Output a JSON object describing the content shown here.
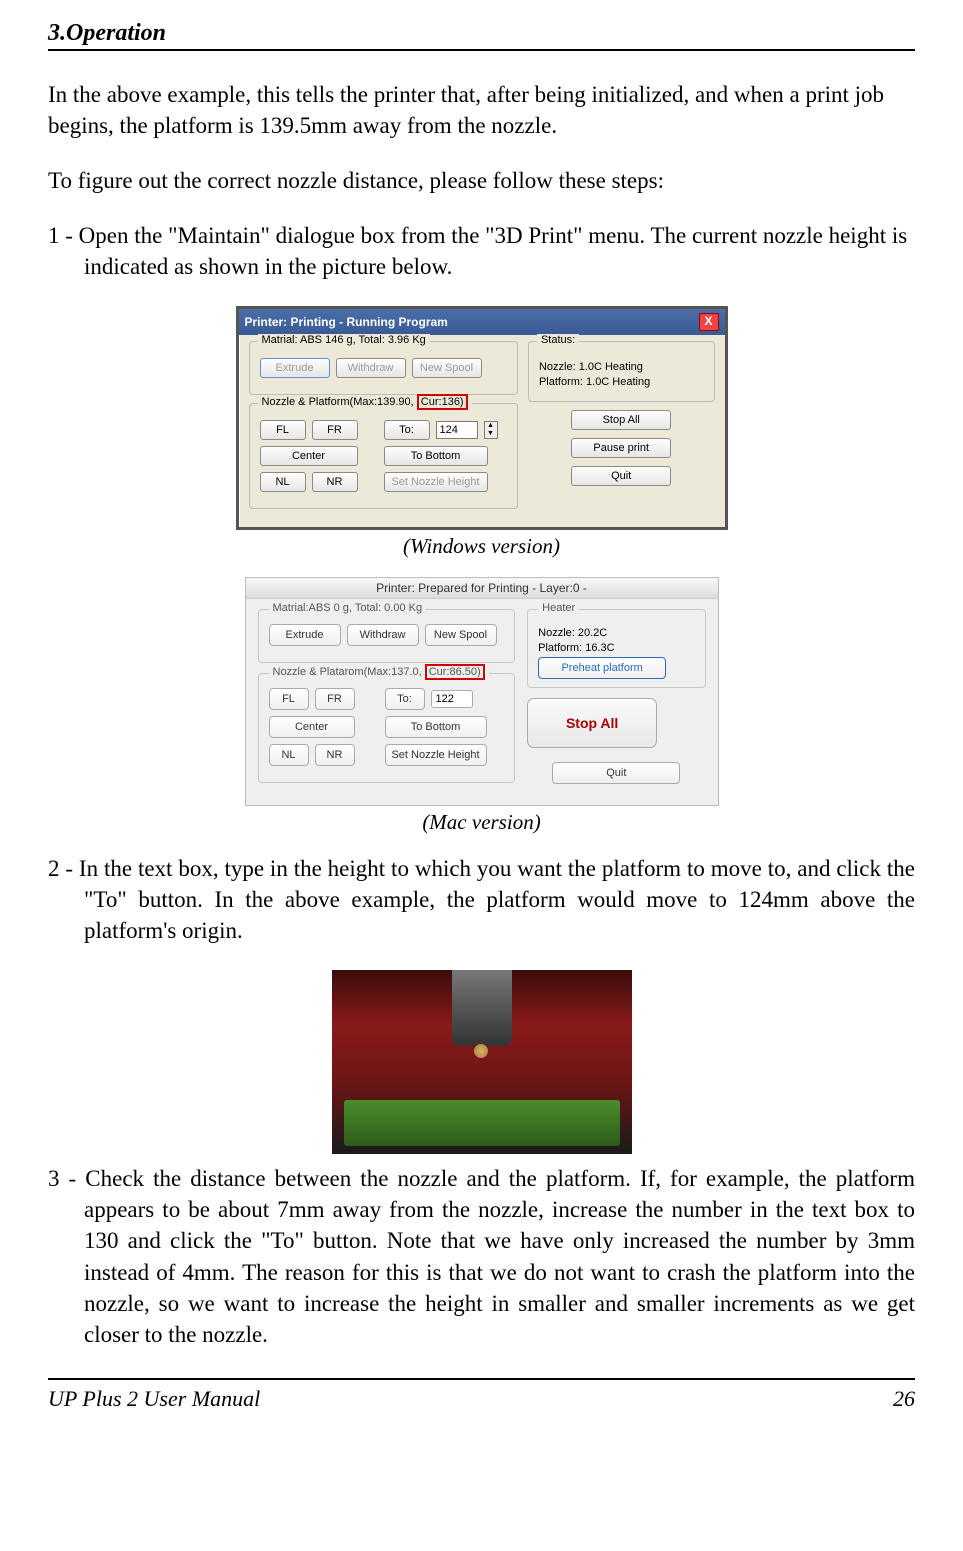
{
  "header": {
    "section": "3.Operation"
  },
  "paragraphs": {
    "intro": "In the above example, this tells the printer that, after being initialized, and when a print job begins, the platform is 139.5mm away from the nozzle.",
    "followSteps": "To figure out the correct nozzle distance, please follow these steps:",
    "step1": "1 - Open the \"Maintain\" dialogue box from the \"3D Print\" menu. The current nozzle height is indicated as shown in the picture below.",
    "step2": "2 - In the text box, type in the height to which you want the platform to move to, and click the \"To\" button. In the above example, the platform would move to 124mm above the platform's origin.",
    "step3": "3 - Check the distance between the nozzle and the platform. If, for example, the platform appears to be about 7mm away from the nozzle, increase the number in the text box to 130 and click the \"To\" button. Note that we have only increased the number by 3mm instead of 4mm. The reason for this is that we do not want to crash the platform into the nozzle, so we want to increase the height in smaller and smaller increments as we get closer to the nozzle."
  },
  "captions": {
    "windows": "(Windows version)",
    "mac": "(Mac version)"
  },
  "winDialog": {
    "title": "Printer: Printing - Running Program",
    "material": "Matrial: ABS 146 g,  Total: 3.96 Kg",
    "buttons": {
      "extrude": "Extrude",
      "withdraw": "Withdraw",
      "newSpool": "New Spool"
    },
    "nozzlePlat": "Nozzle & Platform(Max:139.90,",
    "curHighlight": "Cur:136)",
    "nav": {
      "fl": "FL",
      "fr": "FR",
      "to": "To:",
      "toVal": "124",
      "center": "Center",
      "toBottom": "To Bottom",
      "nl": "NL",
      "nr": "NR",
      "setHeight": "Set Nozzle Height"
    },
    "status": {
      "hdr": "Status:",
      "nozzle": "Nozzle: 1.0C Heating",
      "platform": "Platform: 1.0C Heating",
      "stopAll": "Stop All",
      "pause": "Pause print",
      "quit": "Quit"
    }
  },
  "macDialog": {
    "title": "Printer: Prepared for Printing - Layer:0 -",
    "material": "Matrial:ABS 0 g,  Total: 0.00 Kg",
    "buttons": {
      "extrude": "Extrude",
      "withdraw": "Withdraw",
      "newSpool": "New Spool"
    },
    "nozzlePlat": "Nozzle & Platarom(Max:137.0,",
    "curHighlight": "Cur:86.50)",
    "nav": {
      "fl": "FL",
      "fr": "FR",
      "to": "To:",
      "toVal": "122",
      "center": "Center",
      "toBottom": "To Bottom",
      "nl": "NL",
      "nr": "NR",
      "setHeight": "Set Nozzle  Height"
    },
    "heater": {
      "hdr": "Heater",
      "nozzle": "Nozzle: 20.2C",
      "platform": "Platform: 16.3C",
      "preheat": "Preheat platform",
      "stopAll": "Stop All",
      "quit": "Quit"
    }
  },
  "footer": {
    "left": "UP Plus 2      User  Manual",
    "right": "26"
  }
}
